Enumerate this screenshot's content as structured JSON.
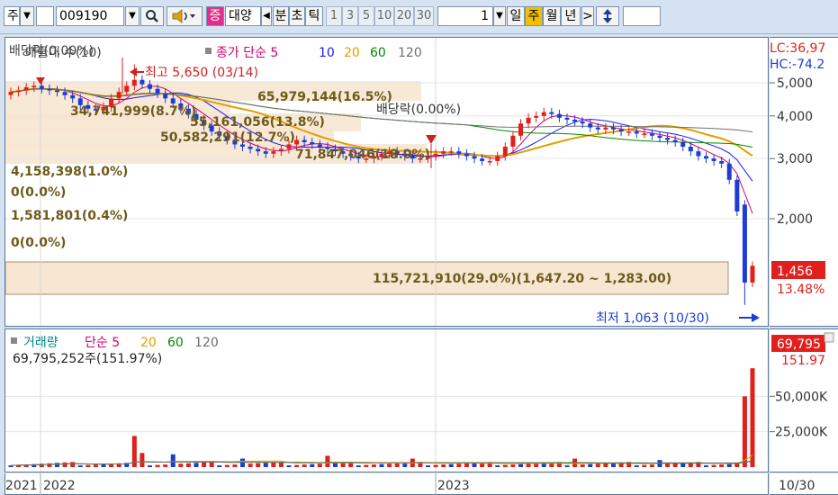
{
  "toolbar": {
    "market": "주",
    "code": "009190",
    "search_icon": "magnifier-icon",
    "speaker_icon": "speaker-icon",
    "badge": "증",
    "stock_name": "대양",
    "period_items": [
      "분",
      "초",
      "틱"
    ],
    "numbers": [
      "1",
      "3",
      "5",
      "10",
      "20",
      "30"
    ],
    "count_value": "1",
    "cycles": [
      "일",
      "주",
      "월",
      "년"
    ],
    "active_cycle": "주",
    "next_label": ">",
    "updown_icon": "up-down-arrow-icon"
  },
  "price_panel": {
    "legend": {
      "clipped_label": "배당락(0.00%)",
      "volume_profile": "매물대 수(10)",
      "ma_prefix": "종가 단순 5",
      "ma_periods": [
        "10",
        "20",
        "60",
        "120"
      ],
      "ma_colors": [
        "#d4006f",
        "#1a1aff",
        "#e0a000",
        "#008a00",
        "#707070"
      ]
    },
    "high_label": "최고 5,650 (03/14)",
    "low_label": "최저 1,063 (10/30)",
    "dividend_label": "배당락(0.00%)",
    "profile_rows": [
      "65,979,144(16.5%)",
      "34,741,999(8.7%)",
      "55,161,056(13.8%)",
      "50,582,291(12.7%)",
      "71,847,046(18.0%)",
      "4,158,398(1.0%)",
      "0(0.0%)",
      "1,581,801(0.4%)",
      "0(0.0%)",
      "115,721,910(29.0%)(1,647.20 ~ 1,283.00)"
    ],
    "lc_label": "LC:36,97",
    "hc_label": "HC:-74.2",
    "y_ticks": [
      "5,000",
      "4,000",
      "3,000",
      "2,000"
    ],
    "last_price": "1,456",
    "last_change": "13.48%"
  },
  "volume_panel": {
    "title": "거래량",
    "ma_prefix": "단순 5",
    "ma_periods": [
      "20",
      "60",
      "120"
    ],
    "value_label": "69,795,252주(151.97%)",
    "y_ticks": [
      "50,000K",
      "25,000K"
    ],
    "last_volume": "69,795",
    "last_ratio": "151.97"
  },
  "x_axis": {
    "labels": [
      "2021",
      "2022",
      "2023"
    ],
    "last_date": "10/30"
  },
  "colors": {
    "up": "#e0201c",
    "down": "#1c3cd8",
    "profile_fill": "#f7e6d2",
    "profile_text": "#6e5a1a"
  },
  "chart_data": {
    "type": "candlestick",
    "title": "대양",
    "period": "weekly",
    "price_markers": {
      "high": 5650,
      "high_date": "03/14",
      "low": 1063,
      "low_date": "10/30"
    },
    "last_close": 1456,
    "last_change_pct": 13.48,
    "last_volume": 69795252,
    "ylabel_ticks": [
      2000,
      3000,
      4000,
      5000
    ],
    "volume_ticks": [
      "25,000K",
      "50,000K"
    ],
    "x_ticks": [
      "2021",
      "2022",
      "2023",
      "10/30"
    ],
    "weeks": 96,
    "close_path": [
      4700,
      4750,
      4850,
      4900,
      4800,
      4750,
      4700,
      4600,
      4500,
      4300,
      4200,
      4150,
      4250,
      4500,
      4700,
      4900,
      5100,
      4950,
      4800,
      4650,
      4500,
      4350,
      4200,
      4050,
      3900,
      3750,
      3600,
      3500,
      3400,
      3300,
      3250,
      3200,
      3150,
      3100,
      3150,
      3200,
      3300,
      3400,
      3350,
      3300,
      3250,
      3200,
      3150,
      3100,
      3050,
      3000,
      3000,
      3050,
      3100,
      3150,
      3100,
      3050,
      3000,
      3000,
      3050,
      3100,
      3150,
      3150,
      3100,
      3050,
      3000,
      2950,
      2950,
      3050,
      3250,
      3500,
      3800,
      3950,
      4000,
      4100,
      4050,
      3950,
      3900,
      3850,
      3800,
      3700,
      3650,
      3700,
      3650,
      3600,
      3600,
      3550,
      3550,
      3500,
      3450,
      3400,
      3350,
      3250,
      3150,
      3050,
      3000,
      2950,
      2900,
      2600,
      2100,
      1300,
      1456
    ]
  }
}
